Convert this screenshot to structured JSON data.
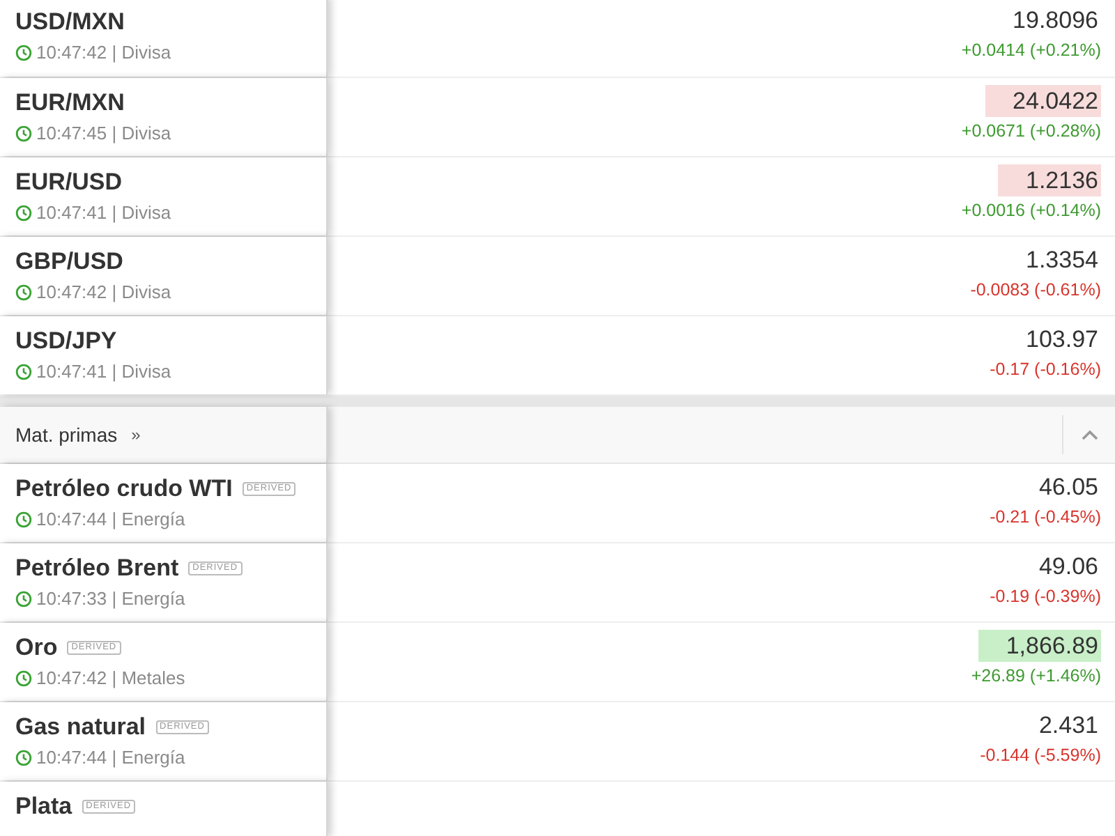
{
  "sections": [
    {
      "rows": [
        {
          "name": "USD/MXN",
          "info": "10:47:42 | Divisa",
          "price": "19.8096",
          "highlighted": false,
          "gain": true,
          "change": "+0.0414 (+0.21%)"
        },
        {
          "name": "EUR/MXN",
          "info": "10:47:45 | Divisa",
          "price": "24.0422",
          "highlighted": true,
          "price_up": false,
          "gain": true,
          "change": "+0.0671 (+0.28%)"
        },
        {
          "name": "EUR/USD",
          "info": "10:47:41 | Divisa",
          "price": "1.2136",
          "highlighted": true,
          "price_up": false,
          "gain": true,
          "change": "+0.0016 (+0.14%)"
        },
        {
          "name": "GBP/USD",
          "info": "10:47:42 | Divisa",
          "price": "1.3354",
          "highlighted": false,
          "gain": false,
          "change": "-0.0083 (-0.61%)"
        },
        {
          "name": "USD/JPY",
          "info": "10:47:41 | Divisa",
          "price": "103.97",
          "highlighted": false,
          "gain": false,
          "change": "-0.17 (-0.16%)"
        }
      ]
    },
    {
      "header": {
        "title": "Mat. primas",
        "more_icon": "»",
        "expanded": true
      },
      "rows": [
        {
          "name": "Petróleo crudo WTI",
          "derived": true,
          "badge": "DERIVED",
          "info": "10:47:44 | Energía",
          "price": "46.05",
          "highlighted": false,
          "gain": false,
          "change": "-0.21 (-0.45%)"
        },
        {
          "name": "Petróleo Brent",
          "derived": true,
          "badge": "DERIVED",
          "info": "10:47:33 | Energía",
          "price": "49.06",
          "highlighted": false,
          "gain": false,
          "change": "-0.19 (-0.39%)"
        },
        {
          "name": "Oro",
          "derived": true,
          "badge": "DERIVED",
          "info": "10:47:42 | Metales",
          "price": "1,866.89",
          "highlighted": true,
          "price_up": true,
          "gain": true,
          "change": "+26.89 (+1.46%)"
        },
        {
          "name": "Gas natural",
          "derived": true,
          "badge": "DERIVED",
          "info": "10:47:44 | Energía",
          "price": "2.431",
          "highlighted": false,
          "gain": false,
          "change": "-0.144 (-5.59%)"
        },
        {
          "name": "Plata",
          "derived": true,
          "badge": "DERIVED"
        }
      ]
    }
  ]
}
